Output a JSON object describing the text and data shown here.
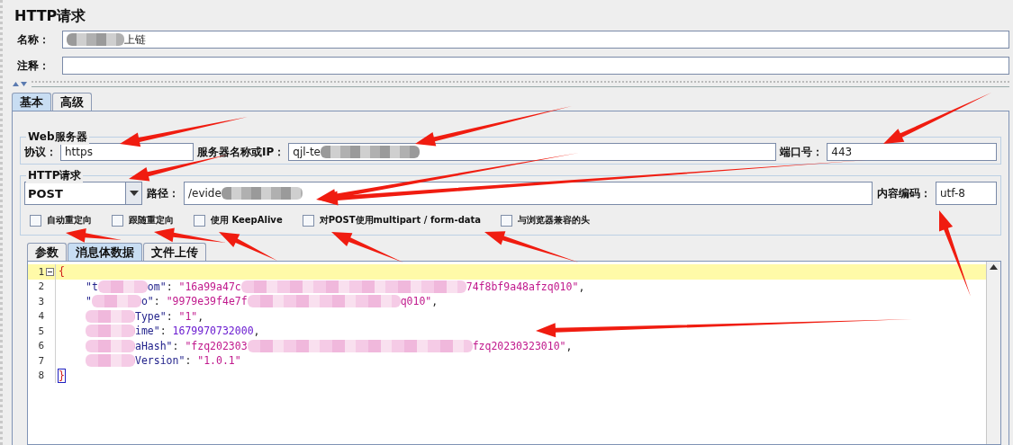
{
  "title": "HTTP请求",
  "name_field": {
    "label": "名称：",
    "segments": [
      {
        "kind": "blur"
      },
      {
        "kind": "text",
        "text": "上链"
      }
    ]
  },
  "comment_field": {
    "label": "注释："
  },
  "tabs": [
    {
      "label": "基本",
      "selected": true
    },
    {
      "label": "高级",
      "selected": false
    }
  ],
  "web_server": {
    "title": "Web服务器",
    "protocol": {
      "label": "协议：",
      "value": "https"
    },
    "server": {
      "label": "服务器名称或IP：",
      "segments": [
        {
          "kind": "text",
          "text": "qjl-te"
        },
        {
          "kind": "blur"
        }
      ]
    },
    "port": {
      "label": "端口号：",
      "value": "443"
    }
  },
  "http_request": {
    "title": "HTTP请求",
    "method": "POST",
    "path": {
      "label": "路径：",
      "segments": [
        {
          "kind": "text",
          "text": "/evide"
        },
        {
          "kind": "blur"
        }
      ]
    },
    "encoding": {
      "label": "内容编码：",
      "value": "utf-8"
    },
    "options": [
      {
        "label": "自动重定向",
        "checked": false
      },
      {
        "label": "跟随重定向",
        "checked": false
      },
      {
        "label": "使用 KeepAlive",
        "checked": false
      },
      {
        "label": "对POST使用multipart / form-data",
        "checked": false
      },
      {
        "label": "与浏览器兼容的头",
        "checked": false
      }
    ]
  },
  "body_tabs": [
    {
      "label": "参数",
      "selected": false
    },
    {
      "label": "消息体数据",
      "selected": true
    },
    {
      "label": "文件上传",
      "selected": false
    }
  ],
  "editor": {
    "lines": [
      {
        "number": "1",
        "current": true,
        "segments": [
          {
            "kind": "bracket",
            "text": "{",
            "matched": false
          }
        ]
      },
      {
        "number": "2",
        "current": false,
        "segments": [
          {
            "kind": "indent"
          },
          {
            "kind": "key",
            "text": "\"t"
          },
          {
            "kind": "blur_short"
          },
          {
            "kind": "key",
            "text": "om\""
          },
          {
            "kind": "punct",
            "text": ": "
          },
          {
            "kind": "str",
            "text": "\"16a99a47c"
          },
          {
            "kind": "blur_long"
          },
          {
            "kind": "str",
            "text": "74f8bf9a48afzq010\""
          },
          {
            "kind": "punct",
            "text": ","
          }
        ]
      },
      {
        "number": "3",
        "current": false,
        "segments": [
          {
            "kind": "indent"
          },
          {
            "kind": "key",
            "text": "\""
          },
          {
            "kind": "blur_short"
          },
          {
            "kind": "key",
            "text": "o\""
          },
          {
            "kind": "punct",
            "text": ": "
          },
          {
            "kind": "str",
            "text": "\"9979e39f4e7f"
          },
          {
            "kind": "blur_medium"
          },
          {
            "kind": "str",
            "text": "q010\""
          },
          {
            "kind": "punct",
            "text": ","
          }
        ]
      },
      {
        "number": "4",
        "current": false,
        "segments": [
          {
            "kind": "indent"
          },
          {
            "kind": "blur_short"
          },
          {
            "kind": "key",
            "text": "Type\""
          },
          {
            "kind": "punct",
            "text": ": "
          },
          {
            "kind": "str",
            "text": "\"1\""
          },
          {
            "kind": "punct",
            "text": ","
          }
        ]
      },
      {
        "number": "5",
        "current": false,
        "segments": [
          {
            "kind": "indent"
          },
          {
            "kind": "blur_short"
          },
          {
            "kind": "key",
            "text": "ime\""
          },
          {
            "kind": "punct",
            "text": ": "
          },
          {
            "kind": "num",
            "text": "1679970732000"
          },
          {
            "kind": "punct",
            "text": ","
          }
        ]
      },
      {
        "number": "6",
        "current": false,
        "segments": [
          {
            "kind": "indent"
          },
          {
            "kind": "blur_short"
          },
          {
            "kind": "key",
            "text": "aHash\""
          },
          {
            "kind": "punct",
            "text": ": "
          },
          {
            "kind": "str",
            "text": "\"fzq202303"
          },
          {
            "kind": "blur_long"
          },
          {
            "kind": "str",
            "text": "fzq20230323010\""
          },
          {
            "kind": "punct",
            "text": ","
          }
        ]
      },
      {
        "number": "7",
        "current": false,
        "segments": [
          {
            "kind": "indent"
          },
          {
            "kind": "blur_short"
          },
          {
            "kind": "key",
            "text": "Version\""
          },
          {
            "kind": "punct",
            "text": ": "
          },
          {
            "kind": "str",
            "text": "\"1.0.1\""
          }
        ]
      },
      {
        "number": "8",
        "current": false,
        "segments": [
          {
            "kind": "bracket",
            "text": "}",
            "matched": true
          }
        ]
      }
    ]
  }
}
